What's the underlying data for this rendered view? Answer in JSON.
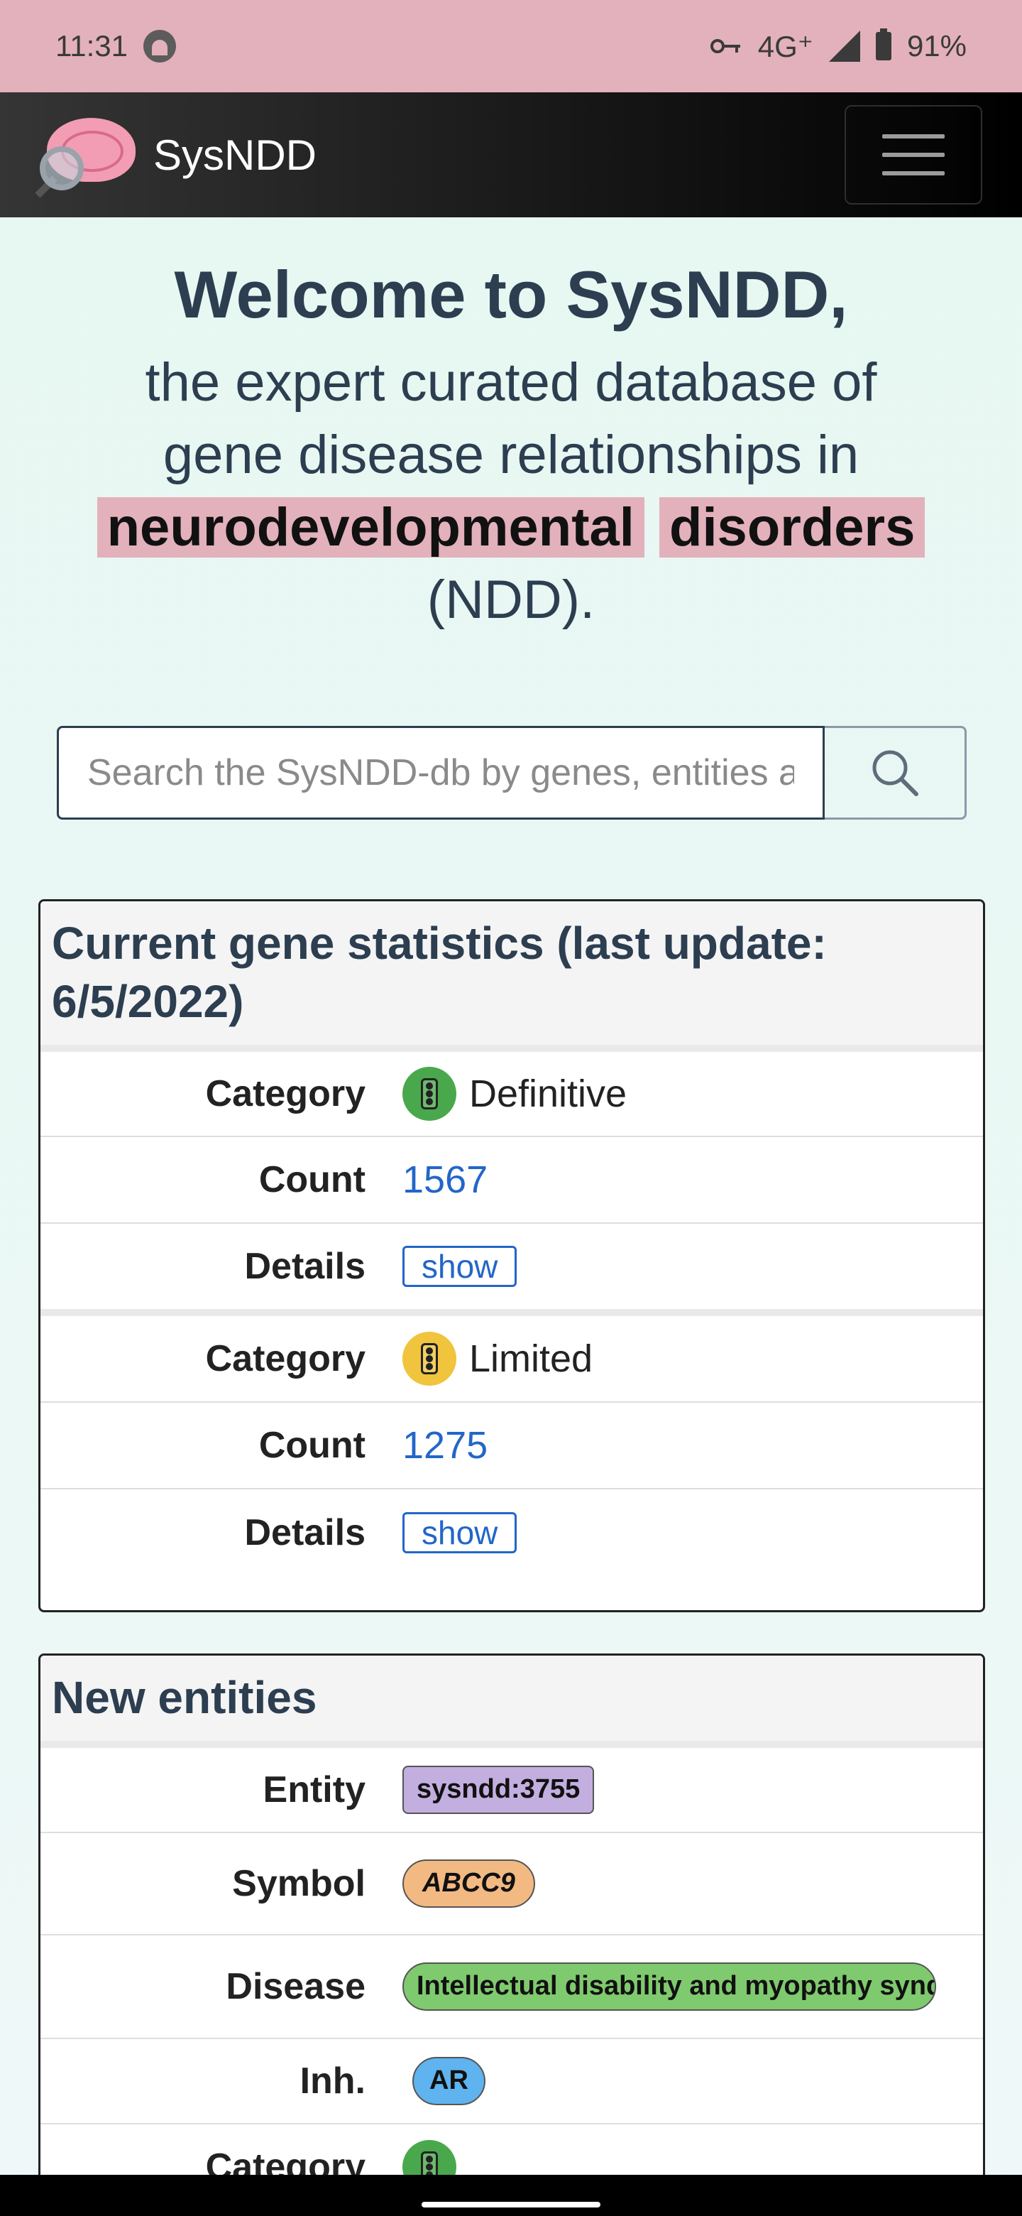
{
  "status_bar": {
    "time": "11:31",
    "network": "4G⁺",
    "battery": "91%",
    "icons": [
      "app-indicator-icon",
      "vpn-key-icon",
      "signal-icon",
      "battery-icon"
    ]
  },
  "navbar": {
    "brand": "SysNDD",
    "logo": "brain-magnifier-logo",
    "menu_icon": "hamburger-menu-icon"
  },
  "hero": {
    "title": "Welcome to SysNDD,",
    "line1": "the expert curated database of",
    "line2": "gene disease relationships in",
    "highlight1": "neurodevelopmental",
    "highlight2": "disorders",
    "line4": "(NDD)."
  },
  "search": {
    "placeholder": "Search the SysNDD-db by genes, entities and diseases",
    "button_icon": "search-icon"
  },
  "gene_stats": {
    "title": "Current gene statistics (last update: 6/5/2022)",
    "groups": [
      {
        "category_label": "Category",
        "category": "Definitive",
        "category_color": "#4aa84c",
        "count_label": "Count",
        "count": "1567",
        "details_label": "Details",
        "details_button": "show"
      },
      {
        "category_label": "Category",
        "category": "Limited",
        "category_color": "#f0c43c",
        "count_label": "Count",
        "count": "1275",
        "details_label": "Details",
        "details_button": "show"
      }
    ]
  },
  "new_entities": {
    "title": "New entities",
    "entity_label": "Entity",
    "entity": "sysndd:3755",
    "symbol_label": "Symbol",
    "symbol": "ABCC9",
    "disease_label": "Disease",
    "disease": "Intellectual disability and myopathy syndrome",
    "inh_label": "Inh.",
    "inh": "AR",
    "category_label": "Category"
  }
}
